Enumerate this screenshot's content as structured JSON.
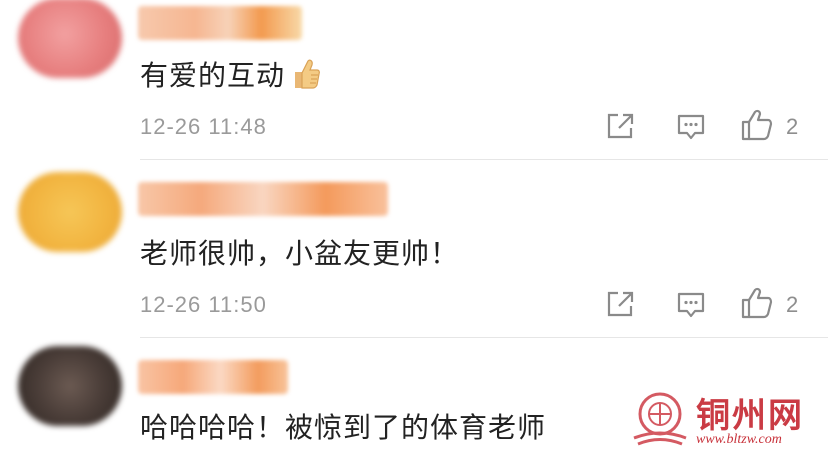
{
  "comments": [
    {
      "text": "有爱的互动",
      "time": "12-26 11:48",
      "likes": "2",
      "emoji": "thumbs-up"
    },
    {
      "text": "老师很帅，小盆友更帅！",
      "time": "12-26 11:50",
      "likes": "2"
    },
    {
      "text": "哈哈哈哈！被惊到了的体育老师"
    }
  ],
  "watermark": {
    "title": "铜州网",
    "url": "www.bltzw.com"
  },
  "colors": {
    "icon": "#8a8a8a",
    "text": "#222222",
    "meta": "#9a9a9a",
    "watermark": "#c8313a"
  }
}
